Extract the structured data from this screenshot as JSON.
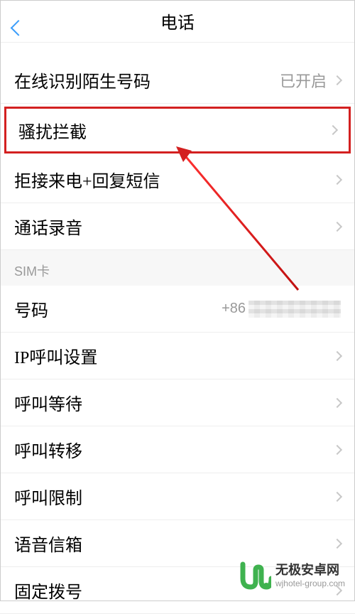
{
  "header": {
    "title": "电话"
  },
  "items": {
    "online_id": {
      "label": "在线识别陌生号码",
      "value": "已开启"
    },
    "harassment_block": {
      "label": "骚扰拦截"
    },
    "reject_reply": {
      "label": "拒接来电+回复短信"
    },
    "call_recording": {
      "label": "通话录音"
    },
    "ip_call": {
      "label": "IP呼叫设置"
    },
    "call_waiting": {
      "label": "呼叫等待"
    },
    "call_forward": {
      "label": "呼叫转移"
    },
    "call_restrict": {
      "label": "呼叫限制"
    },
    "voicemail": {
      "label": "语音信箱"
    },
    "fixed_dial": {
      "label": "固定拨号"
    }
  },
  "sim_section": {
    "label": "SIM卡",
    "phone_label": "号码",
    "phone_prefix": "+86"
  },
  "watermark": {
    "title": "无极安卓网",
    "url": "wjhotel-group.com"
  }
}
